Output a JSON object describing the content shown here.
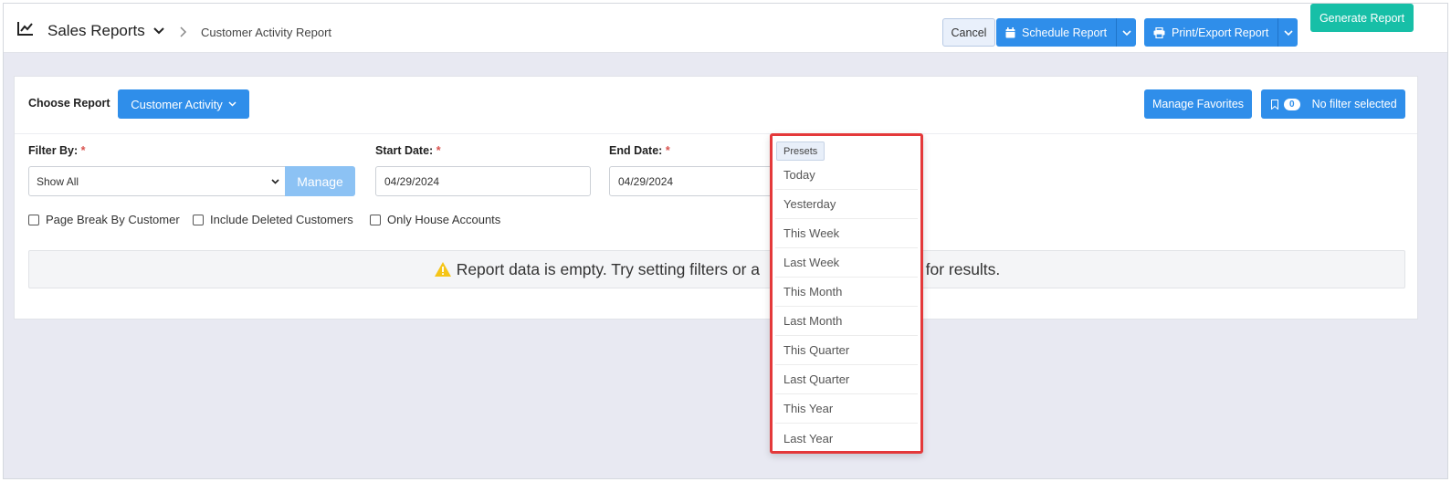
{
  "header": {
    "title": "Sales Reports",
    "breadcrumb": "Customer Activity Report",
    "buttons": {
      "cancel": "Cancel",
      "schedule": "Schedule Report",
      "print_export": "Print/Export Report",
      "generate": "Generate Report"
    }
  },
  "report": {
    "choose_label": "Choose Report",
    "selected_report": "Customer Activity",
    "manage_favorites": "Manage Favorites",
    "filter_count": "0",
    "filter_status": "No filter selected"
  },
  "filters": {
    "filter_by_label": "Filter By:",
    "filter_by_value": "Show All",
    "manage_button": "Manage",
    "start_date_label": "Start Date:",
    "start_date_value": "04/29/2024",
    "end_date_label": "End Date:",
    "end_date_value": "04/29/2024",
    "required_mark": "*",
    "checkboxes": [
      {
        "label": "Page Break By Customer",
        "checked": false
      },
      {
        "label": "Include Deleted Customers",
        "checked": false
      },
      {
        "label": "Only House Accounts",
        "checked": false
      }
    ]
  },
  "empty_message": {
    "visible_start": "Report data is empty. Try setting filters or a",
    "visible_end": "e for results."
  },
  "presets": {
    "tag": "Presets",
    "items": [
      "Today",
      "Yesterday",
      "This Week",
      "Last Week",
      "This Month",
      "Last Month",
      "This Quarter",
      "Last Quarter",
      "This Year",
      "Last Year"
    ]
  },
  "colors": {
    "primary": "#2f8eea",
    "teal": "#17bfa7",
    "manage_disabled": "#8cc2f4",
    "highlight_border": "#e4393a",
    "warning": "#f5c518"
  }
}
